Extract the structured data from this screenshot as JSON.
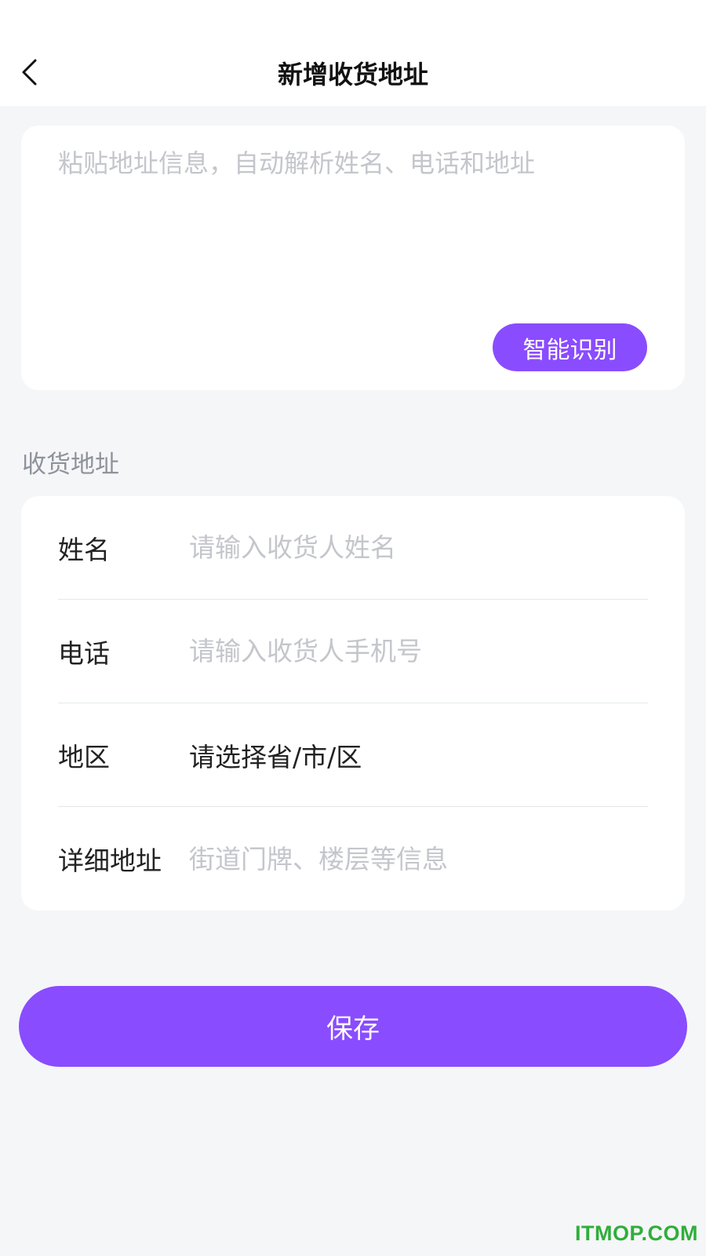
{
  "header": {
    "title": "新增收货地址",
    "back_icon": "chevron-left-icon"
  },
  "paste": {
    "placeholder": "粘贴地址信息，自动解析姓名、电话和地址",
    "value": "",
    "smart_button_label": "智能识别"
  },
  "section": {
    "label": "收货地址"
  },
  "form": {
    "name": {
      "label": "姓名",
      "placeholder": "请输入收货人姓名",
      "value": ""
    },
    "phone": {
      "label": "电话",
      "placeholder": "请输入收货人手机号",
      "value": ""
    },
    "region": {
      "label": "地区",
      "value": "请选择省/市/区"
    },
    "address": {
      "label": "详细地址",
      "placeholder": "街道门牌、楼层等信息",
      "value": ""
    }
  },
  "save_button_label": "保存",
  "watermark": "ITMOP.COM",
  "colors": {
    "accent": "#8a4cff",
    "background": "#f5f6f8",
    "card": "#ffffff",
    "placeholder": "#c4c6cc",
    "section_label": "#8e939b",
    "watermark": "#2fae3a"
  }
}
